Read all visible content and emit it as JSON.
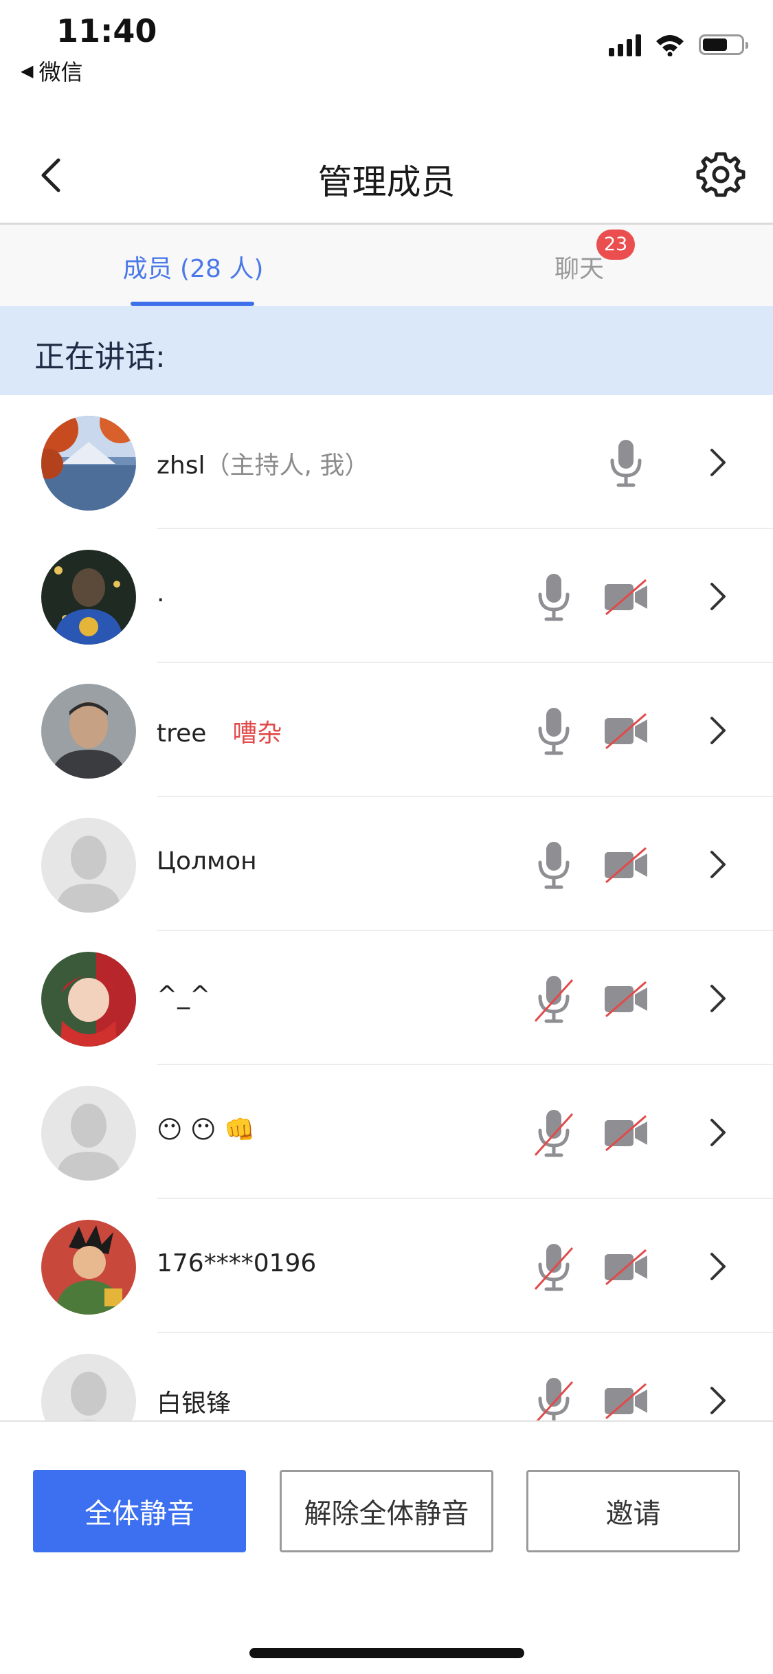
{
  "status_bar": {
    "time": "11:40",
    "back_app": "微信"
  },
  "header": {
    "title": "管理成员"
  },
  "tabs": [
    {
      "label": "成员 (28 人)",
      "active": true
    },
    {
      "label": "聊天",
      "active": false,
      "badge": "23"
    }
  ],
  "speaking_label": "正在讲话:",
  "members": [
    {
      "name": "zhsl",
      "role": "（主持人, 我）",
      "avatar": "photo-landscape"
    },
    {
      "name": ".",
      "avatar": "photo-person-dark"
    },
    {
      "name": "tree",
      "tag": "嘈杂",
      "avatar": "photo-person"
    },
    {
      "name": "Цолмон",
      "avatar": "placeholder"
    },
    {
      "name": "^_^",
      "avatar": "photo-child"
    },
    {
      "name": "😶 😶 👊",
      "avatar": "placeholder"
    },
    {
      "name": "176****0196",
      "avatar": "photo-cartoon"
    },
    {
      "name": "白银锋",
      "avatar": "placeholder"
    }
  ],
  "actions": {
    "mute_all": "全体静音",
    "unmute_all": "解除全体静音",
    "invite": "邀请"
  },
  "colors": {
    "accent": "#3d70f0",
    "badge": "#ea4e4e",
    "noisy": "#e24a4a",
    "speaking_bg": "#dbe8f9"
  }
}
